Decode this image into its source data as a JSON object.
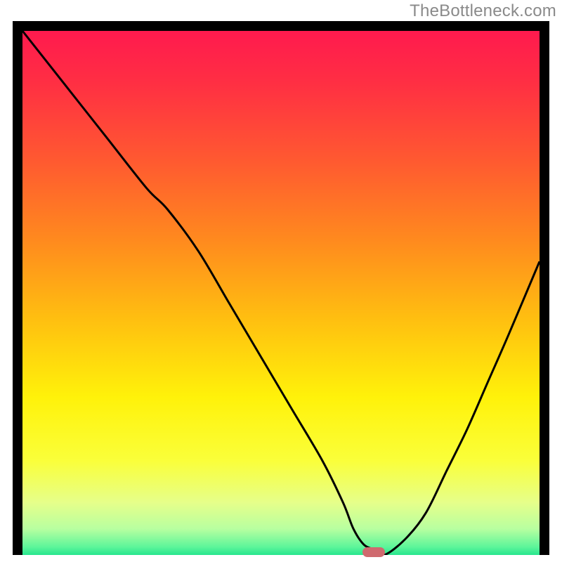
{
  "watermark": {
    "text": "TheBottleneck.com"
  },
  "colors": {
    "border": "#000000",
    "curve": "#000000",
    "marker": "#cf6a6f",
    "watermark": "#8a8a8a",
    "gradient_stops": [
      {
        "offset": 0.0,
        "color": "#ff1a4e"
      },
      {
        "offset": 0.1,
        "color": "#ff2f43"
      },
      {
        "offset": 0.25,
        "color": "#ff5a30"
      },
      {
        "offset": 0.4,
        "color": "#ff8a1e"
      },
      {
        "offset": 0.55,
        "color": "#ffbf10"
      },
      {
        "offset": 0.7,
        "color": "#fff20a"
      },
      {
        "offset": 0.82,
        "color": "#faff3a"
      },
      {
        "offset": 0.9,
        "color": "#e6ff8a"
      },
      {
        "offset": 0.95,
        "color": "#b8ffa0"
      },
      {
        "offset": 0.985,
        "color": "#5cf59a"
      },
      {
        "offset": 1.0,
        "color": "#28e68e"
      }
    ]
  },
  "chart_data": {
    "type": "line",
    "title": "",
    "xlabel": "",
    "ylabel": "",
    "xlim": [
      0,
      100
    ],
    "ylim": [
      0,
      100
    ],
    "grid": false,
    "series": [
      {
        "name": "curve",
        "x": [
          0,
          8,
          16,
          24,
          28,
          34,
          40,
          46,
          52,
          58,
          62,
          64,
          66,
          68,
          70,
          74,
          78,
          82,
          86,
          90,
          94,
          100
        ],
        "y": [
          100,
          90,
          80,
          70,
          66,
          58,
          48,
          38,
          28,
          18,
          10,
          5,
          2,
          1,
          0,
          3,
          8,
          16,
          24,
          33,
          42,
          56
        ]
      }
    ],
    "marker": {
      "x": 68,
      "y": 0.5
    }
  }
}
